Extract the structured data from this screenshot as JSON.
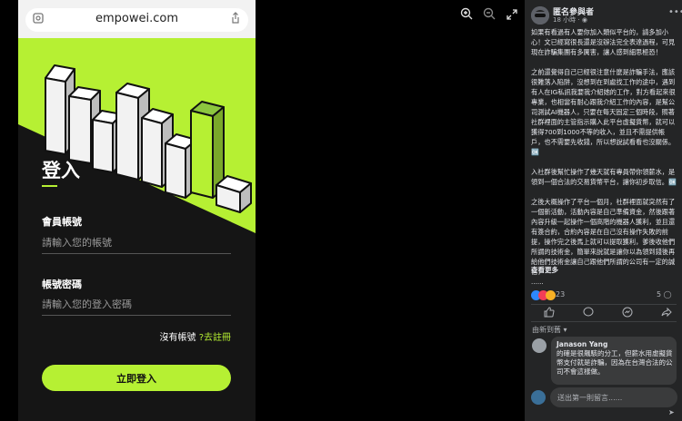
{
  "phone": {
    "url": "empowei.com",
    "form_title": "登入",
    "account_label": "會員帳號",
    "account_placeholder": "請輸入您的帳號",
    "password_label": "帳號密碼",
    "password_placeholder": "請輸入您的登入密碼",
    "no_account_text": "沒有帳號",
    "signup_link": "?去註冊",
    "login_button": "立即登入",
    "accent_color": "#b6f033"
  },
  "viewer": {
    "zoom_in_icon": "zoom-in-icon",
    "zoom_out_icon": "zoom-out-icon",
    "fullscreen_icon": "fullscreen-icon"
  },
  "post": {
    "author": "匿名參與者",
    "time": "18 小時",
    "paragraphs": [
      "如果有看過有人要你加入類似平台的，請多加小心！文已經寫很長還是沒辦法完全表達過程，可見現在詐騙集團有多厲害，讓人感到細思極恐！",
      "之前還覺得自己已經很注意什麼是詐騙手法，應該很難落入陷阱，沒想到在到處找工作的途中，遇到有人在IG私訊我要我介紹她的工作，對方看起來很專業，也相當有耐心跟我介紹工作的內容，是幫公司測試AI機器人，只要在每天固定三個時段，照著社群裡面的主管指示購入此平台虛擬貨幣，就可以獲得700到1000不等的收入，並且不需提供帳戶，也不需要先收錢，所以想說試看看也沒關係。🆗",
      "入社群後幫忙操作了幾天就有專員帶你領薪水，是領到一個合法的交易貨幣平台，讓你初步取信。🆗",
      "之後大概操作了平台一個月，社群裡面就突然有了一個新活動，活動內容是自己準備資金，然後跟著內容升級一起操作一個高階的機器人獲利，並且還有簽合約，合約內容是在自己沒有操作失敗的前提，操作完之後馬上就可以提取獲利，爹後收他們所謂的技術金，簡單來說就是讓你以為領到錢後再給他們技術金讓自己跟他們所謂的公司有一定的誠信，"
    ],
    "ellipsis": "......",
    "see_more": "查看更多",
    "reaction_count": "23",
    "comment_count": "5",
    "sort_label": "由新到舊",
    "comment_author": "Janason Yang",
    "comment_text": "的確是很飆駭的分工，但薪水用虛擬貨幣支付就是詐騙，因為在台灣合法的公司不會這樣做。",
    "composer_placeholder": "送出第一則留言......"
  }
}
